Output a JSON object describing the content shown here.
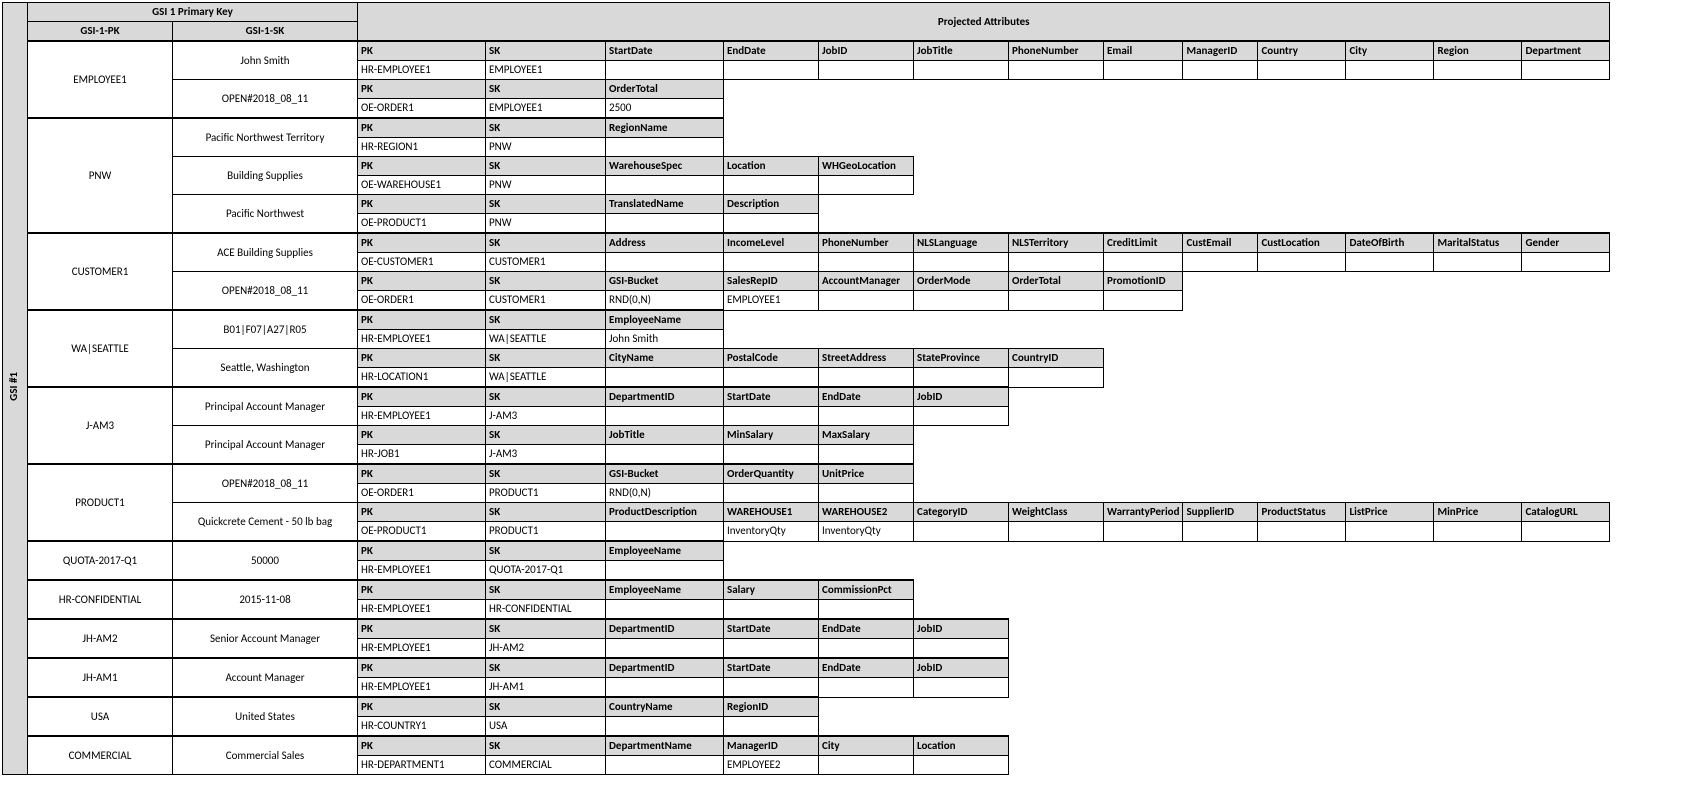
{
  "title_gsi": "GSI #1",
  "top": {
    "primary_key": "GSI 1 Primary Key",
    "projected": "Projected Attributes",
    "gsi_pk": "GSI-1-PK",
    "gsi_sk": "GSI-1-SK"
  },
  "chart_data": {
    "type": "table",
    "description": "DynamoDB GSI #1 layout: GSI-1-PK / GSI-1-SK partitions with projected-attribute mini-tables (header row bold + one data row each).",
    "partitions": [
      {
        "gsi_pk": "EMPLOYEE1",
        "items": [
          {
            "gsi_sk": "John Smith",
            "proj_headers": [
              "PK",
              "SK",
              "StartDate",
              "EndDate",
              "JobID",
              "JobTitle",
              "PhoneNumber",
              "Email",
              "ManagerID",
              "Country",
              "City",
              "Region",
              "Department"
            ],
            "proj_values": [
              "HR-EMPLOYEE1",
              "EMPLOYEE1",
              "",
              "",
              "",
              "",
              "",
              "",
              "",
              "",
              "",
              "",
              ""
            ]
          },
          {
            "gsi_sk": "OPEN#2018_08_11",
            "proj_headers": [
              "PK",
              "SK",
              "OrderTotal"
            ],
            "proj_values": [
              "OE-ORDER1",
              "EMPLOYEE1",
              "2500"
            ]
          }
        ]
      },
      {
        "gsi_pk": "PNW",
        "items": [
          {
            "gsi_sk": "Pacific Northwest Territory",
            "proj_headers": [
              "PK",
              "SK",
              "RegionName"
            ],
            "proj_values": [
              "HR-REGION1",
              "PNW",
              ""
            ]
          },
          {
            "gsi_sk": "Building Supplies",
            "proj_headers": [
              "PK",
              "SK",
              "WarehouseSpec",
              "Location",
              "WHGeoLocation"
            ],
            "proj_values": [
              "OE-WAREHOUSE1",
              "PNW",
              "",
              "",
              ""
            ]
          },
          {
            "gsi_sk": "Pacific Northwest",
            "proj_headers": [
              "PK",
              "SK",
              "TranslatedName",
              "Description"
            ],
            "proj_values": [
              "OE-PRODUCT1",
              "PNW",
              "",
              ""
            ]
          }
        ]
      },
      {
        "gsi_pk": "CUSTOMER1",
        "items": [
          {
            "gsi_sk": "ACE Building Supplies",
            "proj_headers": [
              "PK",
              "SK",
              "Address",
              "IncomeLevel",
              "PhoneNumber",
              "NLSLanguage",
              "NLSTerritory",
              "CreditLimit",
              "CustEmail",
              "CustLocation",
              "DateOfBirth",
              "MaritalStatus",
              "Gender"
            ],
            "proj_values": [
              "OE-CUSTOMER1",
              "CUSTOMER1",
              "",
              "",
              "",
              "",
              "",
              "",
              "",
              "",
              "",
              "",
              ""
            ]
          },
          {
            "gsi_sk": "OPEN#2018_08_11",
            "proj_headers": [
              "PK",
              "SK",
              "GSI-Bucket",
              "SalesRepID",
              "AccountManager",
              "OrderMode",
              "OrderTotal",
              "PromotionID"
            ],
            "proj_values": [
              "OE-ORDER1",
              "CUSTOMER1",
              "RND(0,N)",
              "EMPLOYEE1",
              "",
              "",
              "",
              ""
            ]
          }
        ]
      },
      {
        "gsi_pk": "WA|SEATTLE",
        "items": [
          {
            "gsi_sk": "B01|F07|A27|R05",
            "proj_headers": [
              "PK",
              "SK",
              "EmployeeName"
            ],
            "proj_values": [
              "HR-EMPLOYEE1",
              "WA|SEATTLE",
              "John Smith"
            ]
          },
          {
            "gsi_sk": "Seattle, Washington",
            "proj_headers": [
              "PK",
              "SK",
              "CityName",
              "PostalCode",
              "StreetAddress",
              "StateProvince",
              "CountryID"
            ],
            "proj_values": [
              "HR-LOCATION1",
              "WA|SEATTLE",
              "",
              "",
              "",
              "",
              ""
            ]
          }
        ]
      },
      {
        "gsi_pk": "J-AM3",
        "items": [
          {
            "gsi_sk": "Principal Account Manager",
            "proj_headers": [
              "PK",
              "SK",
              "DepartmentID",
              "StartDate",
              "EndDate",
              "JobID"
            ],
            "proj_values": [
              "HR-EMPLOYEE1",
              "J-AM3",
              "",
              "",
              "",
              ""
            ]
          },
          {
            "gsi_sk": "Principal Account Manager",
            "proj_headers": [
              "PK",
              "SK",
              "JobTitle",
              "MinSalary",
              "MaxSalary"
            ],
            "proj_values": [
              "HR-JOB1",
              "J-AM3",
              "",
              "",
              ""
            ]
          }
        ]
      },
      {
        "gsi_pk": "PRODUCT1",
        "items": [
          {
            "gsi_sk": "OPEN#2018_08_11",
            "proj_headers": [
              "PK",
              "SK",
              "GSI-Bucket",
              "OrderQuantity",
              "UnitPrice"
            ],
            "proj_values": [
              "OE-ORDER1",
              "PRODUCT1",
              "RND(0,N)",
              "",
              ""
            ]
          },
          {
            "gsi_sk": "Quickcrete Cement - 50 lb bag",
            "proj_headers": [
              "PK",
              "SK",
              "ProductDescription",
              "WAREHOUSE1",
              "WAREHOUSE2",
              "CategoryID",
              "WeightClass",
              "WarrantyPeriod",
              "SupplierID",
              "ProductStatus",
              "ListPrice",
              "MinPrice",
              "CatalogURL"
            ],
            "proj_values": [
              "OE-PRODUCT1",
              "PRODUCT1",
              "",
              "InventoryQty",
              "InventoryQty",
              "",
              "",
              "",
              "",
              "",
              "",
              "",
              ""
            ]
          }
        ]
      },
      {
        "gsi_pk": "QUOTA-2017-Q1",
        "items": [
          {
            "gsi_sk": "50000",
            "proj_headers": [
              "PK",
              "SK",
              "EmployeeName"
            ],
            "proj_values": [
              "HR-EMPLOYEE1",
              "QUOTA-2017-Q1",
              ""
            ]
          }
        ]
      },
      {
        "gsi_pk": "HR-CONFIDENTIAL",
        "items": [
          {
            "gsi_sk": "2015-11-08",
            "proj_headers": [
              "PK",
              "SK",
              "EmployeeName",
              "Salary",
              "CommissionPct"
            ],
            "proj_values": [
              "HR-EMPLOYEE1",
              "HR-CONFIDENTIAL",
              "",
              "",
              ""
            ]
          }
        ]
      },
      {
        "gsi_pk": "JH-AM2",
        "items": [
          {
            "gsi_sk": "Senior Account Manager",
            "proj_headers": [
              "PK",
              "SK",
              "DepartmentID",
              "StartDate",
              "EndDate",
              "JobID"
            ],
            "proj_values": [
              "HR-EMPLOYEE1",
              "JH-AM2",
              "",
              "",
              "",
              ""
            ]
          }
        ]
      },
      {
        "gsi_pk": "JH-AM1",
        "items": [
          {
            "gsi_sk": "Account Manager",
            "proj_headers": [
              "PK",
              "SK",
              "DepartmentID",
              "StartDate",
              "EndDate",
              "JobID"
            ],
            "proj_values": [
              "HR-EMPLOYEE1",
              "JH-AM1",
              "",
              "",
              "",
              ""
            ]
          }
        ]
      },
      {
        "gsi_pk": "USA",
        "items": [
          {
            "gsi_sk": "United States",
            "proj_headers": [
              "PK",
              "SK",
              "CountryName",
              "RegionID"
            ],
            "proj_values": [
              "HR-COUNTRY1",
              "USA",
              "",
              ""
            ]
          }
        ]
      },
      {
        "gsi_pk": "COMMERCIAL",
        "items": [
          {
            "gsi_sk": "Commercial Sales",
            "proj_headers": [
              "PK",
              "SK",
              "DepartmentName",
              "ManagerID",
              "City",
              "Location"
            ],
            "proj_values": [
              "HR-DEPARTMENT1",
              "COMMERCIAL",
              "",
              "EMPLOYEE2",
              "",
              ""
            ]
          }
        ]
      }
    ]
  },
  "col_widths": {
    "rot": 18,
    "pk": 145,
    "sk": 185,
    "proj_first": 128,
    "proj_second": 120,
    "proj_third": 118,
    "proj_rest": 93,
    "proj_narrow": 75,
    "proj_wide": 88
  }
}
